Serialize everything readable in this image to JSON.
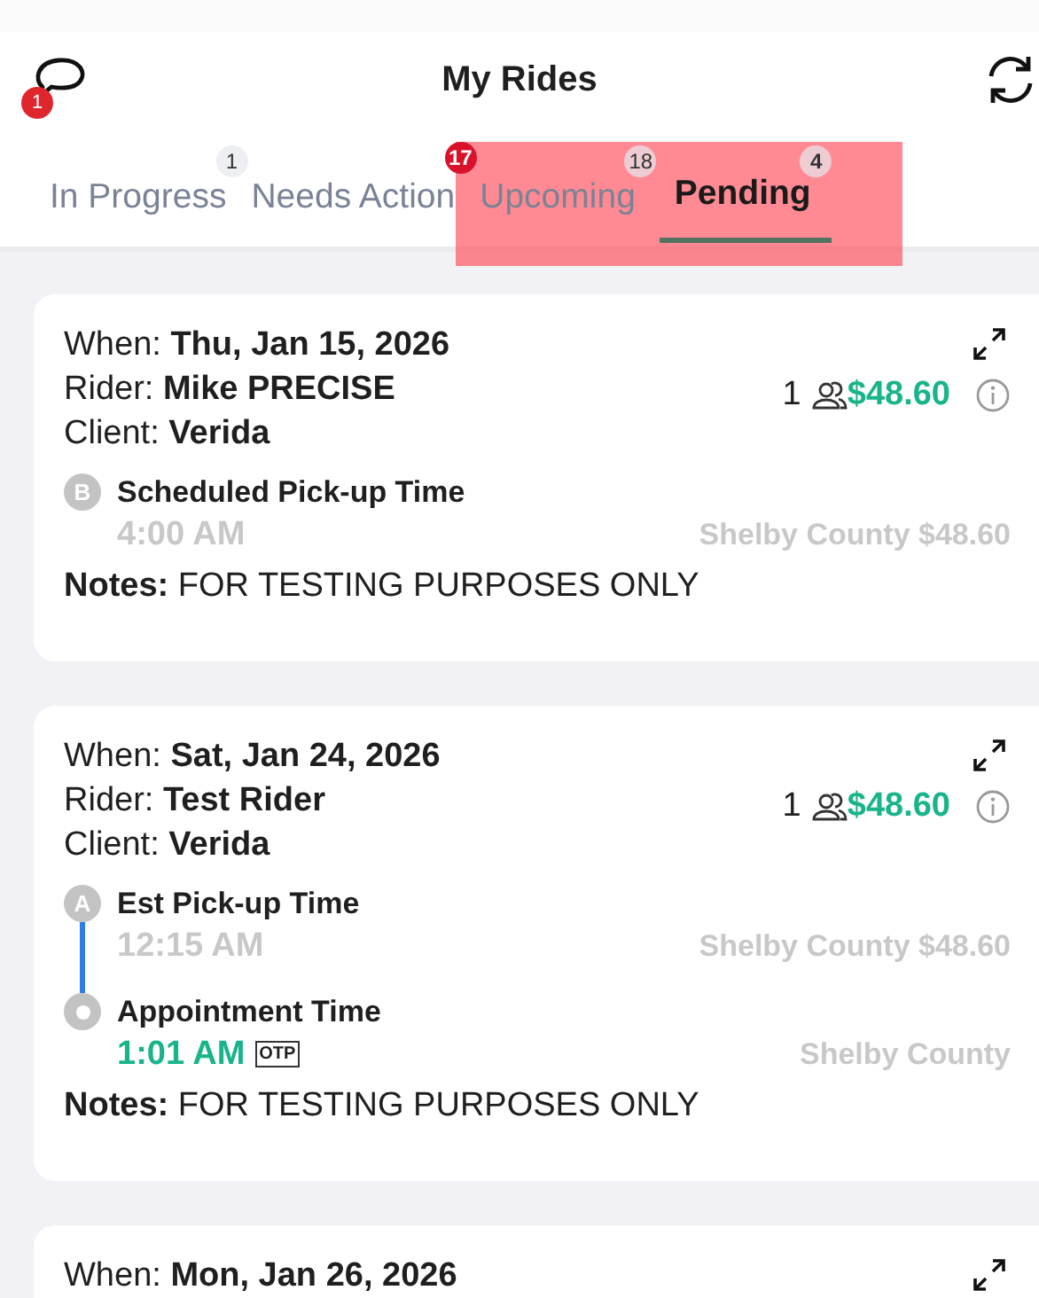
{
  "header": {
    "title": "My Rides",
    "chat_badge": "1"
  },
  "tabs": [
    {
      "label": "In Progress",
      "count": "1",
      "alert": false,
      "selected": false,
      "highlighted": false
    },
    {
      "label": "Needs Action",
      "count": "17",
      "alert": true,
      "selected": false,
      "highlighted": false
    },
    {
      "label": "Upcoming",
      "count": "18",
      "alert": false,
      "selected": false,
      "highlighted": true
    },
    {
      "label": "Pending",
      "count": "4",
      "alert": false,
      "selected": true,
      "highlighted": true
    }
  ],
  "rides": [
    {
      "when": "When: **Thu, Jan 15, 2026**",
      "rider": "Rider: **Mike PRECISE**",
      "client": "Client: **Verida**",
      "passengers": "1",
      "fare": "$48.60",
      "stops": [
        {
          "marker": {
            "kind": "letter",
            "text": "B"
          },
          "label": "Scheduled Pick-up Time",
          "time": "4:00 AM",
          "confirmed": false,
          "area": "Shelby County $48.60"
        }
      ],
      "notes": "**Notes:** FOR TESTING PURPOSES ONLY"
    },
    {
      "when": "When: **Sat, Jan 24, 2026**",
      "rider": "Rider: **Test Rider**",
      "client": "Client: **Verida**",
      "passengers": "1",
      "fare": "$48.60",
      "stops": [
        {
          "marker": {
            "kind": "letter",
            "text": "A"
          },
          "label": "Est Pick-up Time",
          "time": "12:15 AM",
          "confirmed": false,
          "area": "Shelby County $48.60"
        },
        {
          "marker": {
            "kind": "dot"
          },
          "label": "Appointment Time",
          "time": "1:01 AM",
          "confirmed": true,
          "badge": "OTP",
          "area": "Shelby County"
        }
      ],
      "notes": "**Notes:** FOR TESTING PURPOSES ONLY"
    },
    {
      "when": "When: **Mon, Jan 26, 2026**"
    }
  ]
}
